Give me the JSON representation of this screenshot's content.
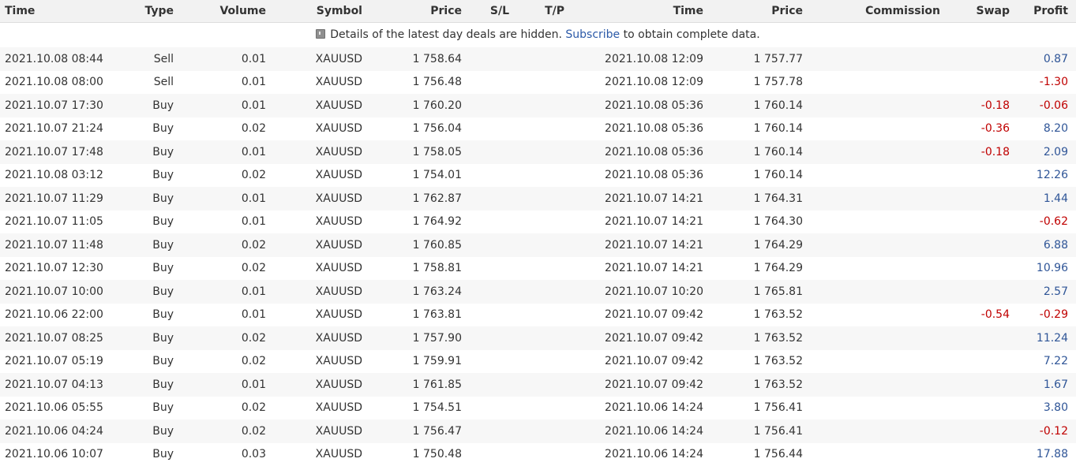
{
  "headers": [
    "Time",
    "Type",
    "Volume",
    "Symbol",
    "Price",
    "S/L",
    "T/P",
    "Time",
    "Price",
    "Commission",
    "Swap",
    "Profit"
  ],
  "notice": {
    "before": "Details of the latest day deals are hidden.",
    "link": "Subscribe",
    "after": "to obtain complete data."
  },
  "colors": {
    "positive": "#2f5597",
    "negative": "#c00000",
    "stripe": "#f7f7f7",
    "header_bg": "#f2f2f2"
  },
  "rows": [
    {
      "open_time": "2021.10.08 08:44",
      "type": "Sell",
      "volume": "0.01",
      "symbol": "XAUUSD",
      "open_price": "1 758.64",
      "sl": "",
      "tp": "",
      "close_time": "2021.10.08 12:09",
      "close_price": "1 757.77",
      "commission": "",
      "swap": "",
      "profit": "0.87"
    },
    {
      "open_time": "2021.10.08 08:00",
      "type": "Sell",
      "volume": "0.01",
      "symbol": "XAUUSD",
      "open_price": "1 756.48",
      "sl": "",
      "tp": "",
      "close_time": "2021.10.08 12:09",
      "close_price": "1 757.78",
      "commission": "",
      "swap": "",
      "profit": "-1.30"
    },
    {
      "open_time": "2021.10.07 17:30",
      "type": "Buy",
      "volume": "0.01",
      "symbol": "XAUUSD",
      "open_price": "1 760.20",
      "sl": "",
      "tp": "",
      "close_time": "2021.10.08 05:36",
      "close_price": "1 760.14",
      "commission": "",
      "swap": "-0.18",
      "profit": "-0.06"
    },
    {
      "open_time": "2021.10.07 21:24",
      "type": "Buy",
      "volume": "0.02",
      "symbol": "XAUUSD",
      "open_price": "1 756.04",
      "sl": "",
      "tp": "",
      "close_time": "2021.10.08 05:36",
      "close_price": "1 760.14",
      "commission": "",
      "swap": "-0.36",
      "profit": "8.20"
    },
    {
      "open_time": "2021.10.07 17:48",
      "type": "Buy",
      "volume": "0.01",
      "symbol": "XAUUSD",
      "open_price": "1 758.05",
      "sl": "",
      "tp": "",
      "close_time": "2021.10.08 05:36",
      "close_price": "1 760.14",
      "commission": "",
      "swap": "-0.18",
      "profit": "2.09"
    },
    {
      "open_time": "2021.10.08 03:12",
      "type": "Buy",
      "volume": "0.02",
      "symbol": "XAUUSD",
      "open_price": "1 754.01",
      "sl": "",
      "tp": "",
      "close_time": "2021.10.08 05:36",
      "close_price": "1 760.14",
      "commission": "",
      "swap": "",
      "profit": "12.26"
    },
    {
      "open_time": "2021.10.07 11:29",
      "type": "Buy",
      "volume": "0.01",
      "symbol": "XAUUSD",
      "open_price": "1 762.87",
      "sl": "",
      "tp": "",
      "close_time": "2021.10.07 14:21",
      "close_price": "1 764.31",
      "commission": "",
      "swap": "",
      "profit": "1.44"
    },
    {
      "open_time": "2021.10.07 11:05",
      "type": "Buy",
      "volume": "0.01",
      "symbol": "XAUUSD",
      "open_price": "1 764.92",
      "sl": "",
      "tp": "",
      "close_time": "2021.10.07 14:21",
      "close_price": "1 764.30",
      "commission": "",
      "swap": "",
      "profit": "-0.62"
    },
    {
      "open_time": "2021.10.07 11:48",
      "type": "Buy",
      "volume": "0.02",
      "symbol": "XAUUSD",
      "open_price": "1 760.85",
      "sl": "",
      "tp": "",
      "close_time": "2021.10.07 14:21",
      "close_price": "1 764.29",
      "commission": "",
      "swap": "",
      "profit": "6.88"
    },
    {
      "open_time": "2021.10.07 12:30",
      "type": "Buy",
      "volume": "0.02",
      "symbol": "XAUUSD",
      "open_price": "1 758.81",
      "sl": "",
      "tp": "",
      "close_time": "2021.10.07 14:21",
      "close_price": "1 764.29",
      "commission": "",
      "swap": "",
      "profit": "10.96"
    },
    {
      "open_time": "2021.10.07 10:00",
      "type": "Buy",
      "volume": "0.01",
      "symbol": "XAUUSD",
      "open_price": "1 763.24",
      "sl": "",
      "tp": "",
      "close_time": "2021.10.07 10:20",
      "close_price": "1 765.81",
      "commission": "",
      "swap": "",
      "profit": "2.57"
    },
    {
      "open_time": "2021.10.06 22:00",
      "type": "Buy",
      "volume": "0.01",
      "symbol": "XAUUSD",
      "open_price": "1 763.81",
      "sl": "",
      "tp": "",
      "close_time": "2021.10.07 09:42",
      "close_price": "1 763.52",
      "commission": "",
      "swap": "-0.54",
      "profit": "-0.29"
    },
    {
      "open_time": "2021.10.07 08:25",
      "type": "Buy",
      "volume": "0.02",
      "symbol": "XAUUSD",
      "open_price": "1 757.90",
      "sl": "",
      "tp": "",
      "close_time": "2021.10.07 09:42",
      "close_price": "1 763.52",
      "commission": "",
      "swap": "",
      "profit": "11.24"
    },
    {
      "open_time": "2021.10.07 05:19",
      "type": "Buy",
      "volume": "0.02",
      "symbol": "XAUUSD",
      "open_price": "1 759.91",
      "sl": "",
      "tp": "",
      "close_time": "2021.10.07 09:42",
      "close_price": "1 763.52",
      "commission": "",
      "swap": "",
      "profit": "7.22"
    },
    {
      "open_time": "2021.10.07 04:13",
      "type": "Buy",
      "volume": "0.01",
      "symbol": "XAUUSD",
      "open_price": "1 761.85",
      "sl": "",
      "tp": "",
      "close_time": "2021.10.07 09:42",
      "close_price": "1 763.52",
      "commission": "",
      "swap": "",
      "profit": "1.67"
    },
    {
      "open_time": "2021.10.06 05:55",
      "type": "Buy",
      "volume": "0.02",
      "symbol": "XAUUSD",
      "open_price": "1 754.51",
      "sl": "",
      "tp": "",
      "close_time": "2021.10.06 14:24",
      "close_price": "1 756.41",
      "commission": "",
      "swap": "",
      "profit": "3.80"
    },
    {
      "open_time": "2021.10.06 04:24",
      "type": "Buy",
      "volume": "0.02",
      "symbol": "XAUUSD",
      "open_price": "1 756.47",
      "sl": "",
      "tp": "",
      "close_time": "2021.10.06 14:24",
      "close_price": "1 756.41",
      "commission": "",
      "swap": "",
      "profit": "-0.12"
    },
    {
      "open_time": "2021.10.06 10:07",
      "type": "Buy",
      "volume": "0.03",
      "symbol": "XAUUSD",
      "open_price": "1 750.48",
      "sl": "",
      "tp": "",
      "close_time": "2021.10.06 14:24",
      "close_price": "1 756.44",
      "commission": "",
      "swap": "",
      "profit": "17.88"
    }
  ]
}
